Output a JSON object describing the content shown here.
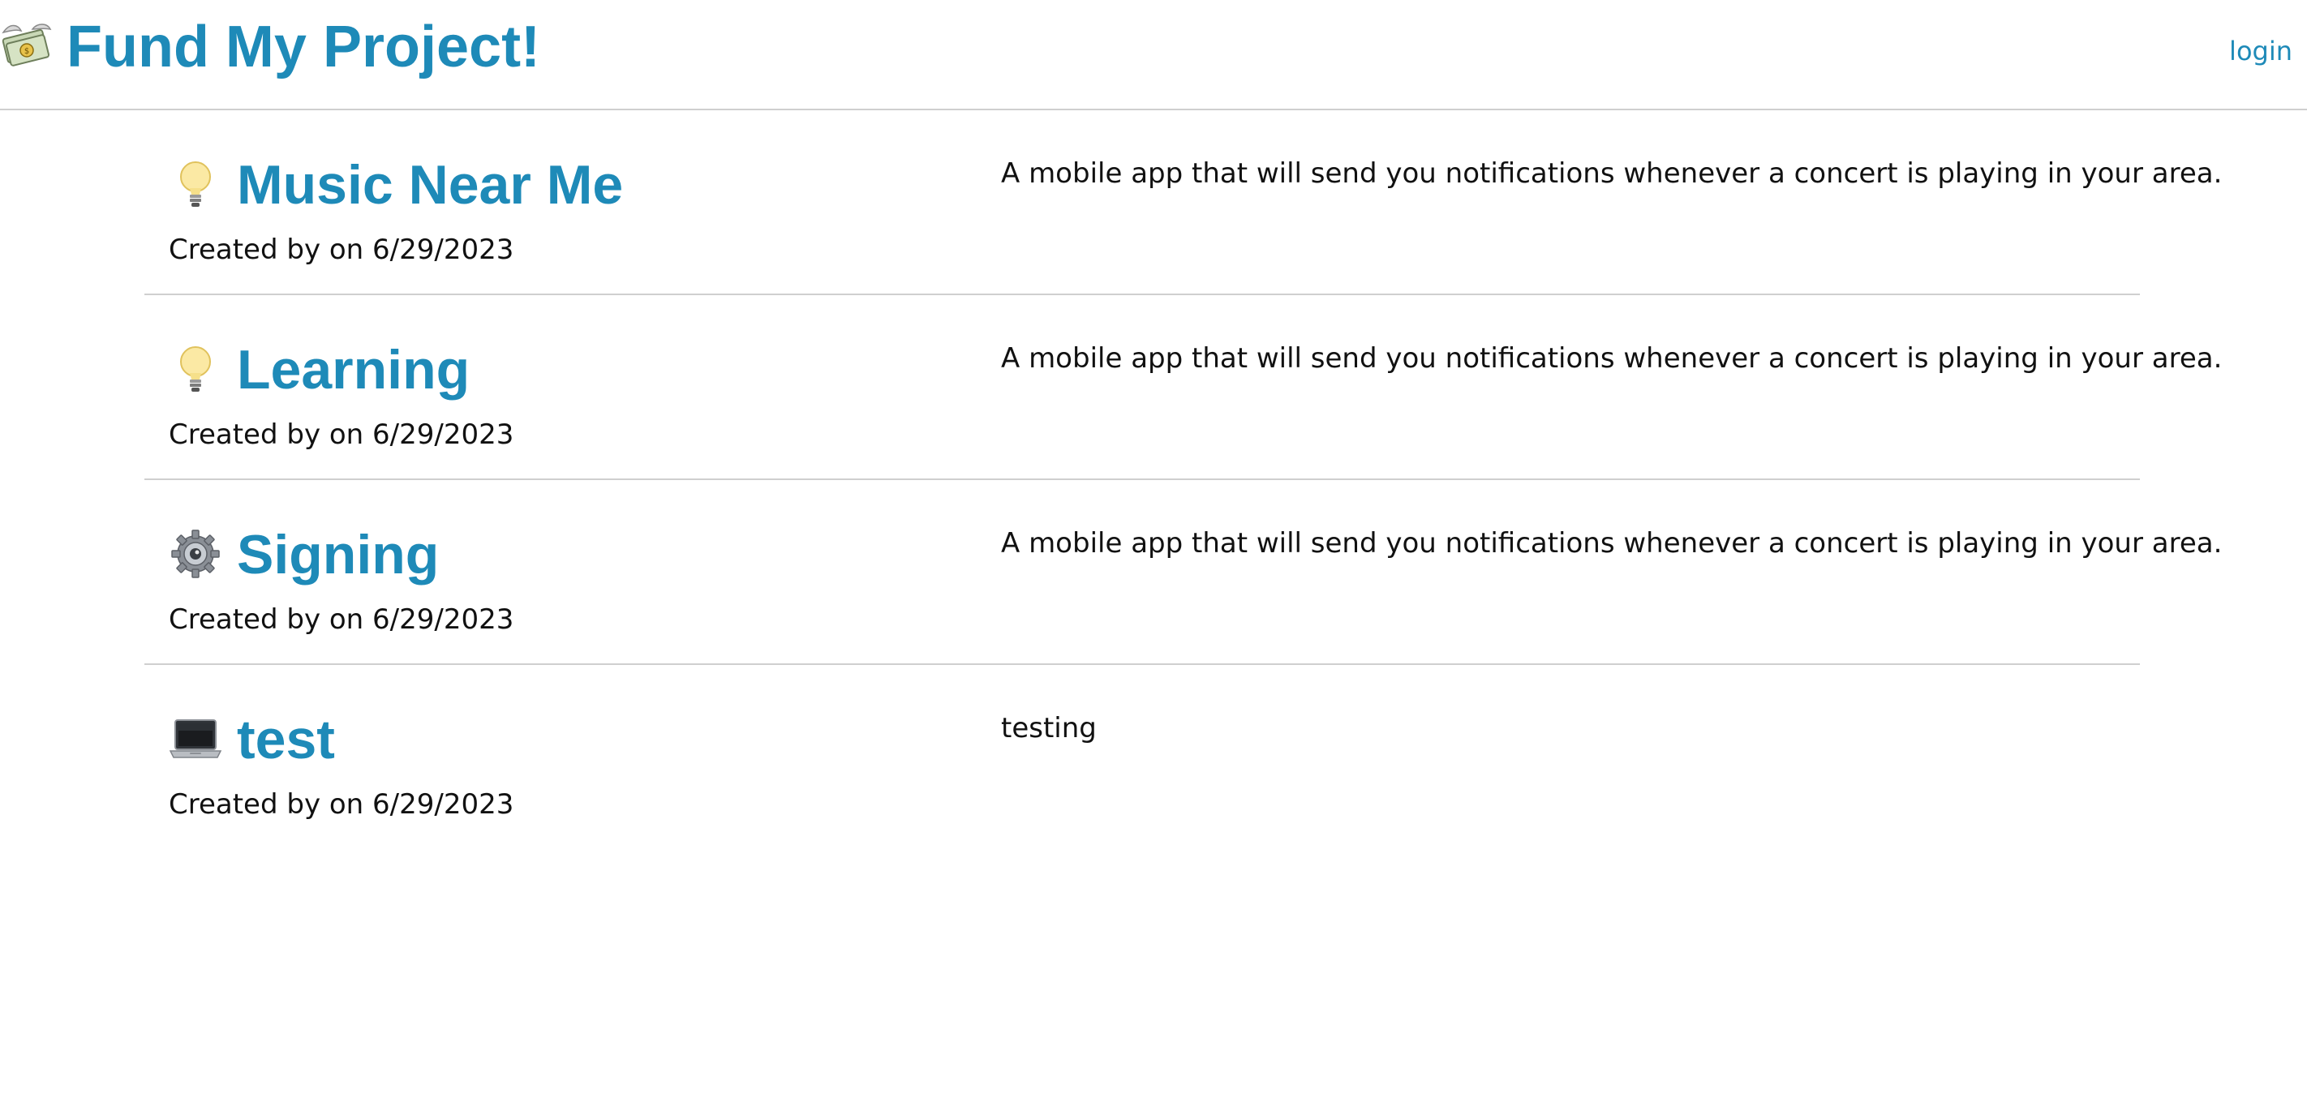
{
  "header": {
    "logo_icon": "money-with-wings-icon",
    "title": "Fund My Project!",
    "login_label": "login"
  },
  "projects": [
    {
      "icon": "light-bulb-icon",
      "title": "Music Near Me",
      "meta": "Created by on 6/29/2023",
      "description": "A mobile app that will send you notifications whenever a concert is playing in your area."
    },
    {
      "icon": "light-bulb-icon",
      "title": "Learning",
      "meta": "Created by on 6/29/2023",
      "description": "A mobile app that will send you notifications whenever a concert is playing in your area."
    },
    {
      "icon": "gear-icon",
      "title": "Signing",
      "meta": "Created by on 6/29/2023",
      "description": "A mobile app that will send you notifications whenever a concert is playing in your area."
    },
    {
      "icon": "laptop-icon",
      "title": "test",
      "meta": "Created by on 6/29/2023",
      "description": "testing"
    }
  ],
  "colors": {
    "accent": "#1e8ab8",
    "divider": "#cfcfcf",
    "text": "#111111",
    "background": "#ffffff"
  }
}
